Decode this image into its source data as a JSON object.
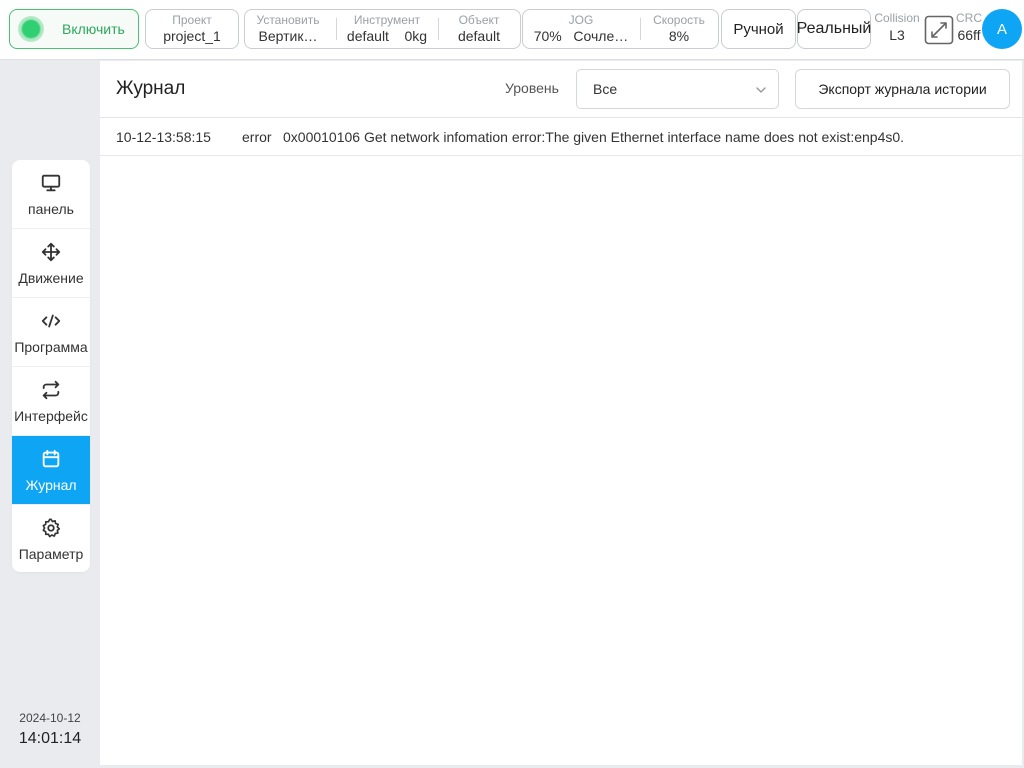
{
  "topbar": {
    "power_label": "Включить",
    "project": {
      "caption": "Проект",
      "value": "project_1"
    },
    "install": {
      "caption": "Установить",
      "value": "Вертик…"
    },
    "tool": {
      "caption": "Инструмент",
      "value": "default",
      "weight": "0kg"
    },
    "object": {
      "caption": "Объект",
      "value": "default"
    },
    "jog": {
      "caption": "JOG",
      "percent": "70%",
      "mode": "Сочле…"
    },
    "speed": {
      "caption": "Скорость",
      "value": "8%"
    },
    "manual_label": "Ручной",
    "real_label": "Реальный",
    "collision": {
      "caption": "Collision",
      "value": "L3"
    },
    "crc": {
      "caption": "CRC",
      "value": "66ff"
    },
    "avatar_letter": "A"
  },
  "sidebar": {
    "items": [
      {
        "label": "панель",
        "icon": "monitor-icon"
      },
      {
        "label": "Движение",
        "icon": "move-icon"
      },
      {
        "label": "Программа",
        "icon": "code-icon"
      },
      {
        "label": "Интерфейс",
        "icon": "repeat-icon"
      },
      {
        "label": "Журнал",
        "icon": "calendar-icon",
        "active": true
      },
      {
        "label": "Параметр",
        "icon": "gear-icon"
      }
    ]
  },
  "clock": {
    "date": "2024-10-12",
    "time": "14:01:14"
  },
  "main": {
    "title": "Журнал",
    "level_label": "Уровень",
    "level_value": "Все",
    "export_label": "Экспорт журнала истории",
    "logs": [
      {
        "time": "10-12-13:58:15",
        "level": "error",
        "message": "0x00010106 Get network infomation error:The given Ethernet interface name does not exist:enp4s0."
      }
    ]
  },
  "colors": {
    "accent": "#0ea5f5",
    "power_green": "#2fcf72",
    "background": "#e9ebee"
  }
}
